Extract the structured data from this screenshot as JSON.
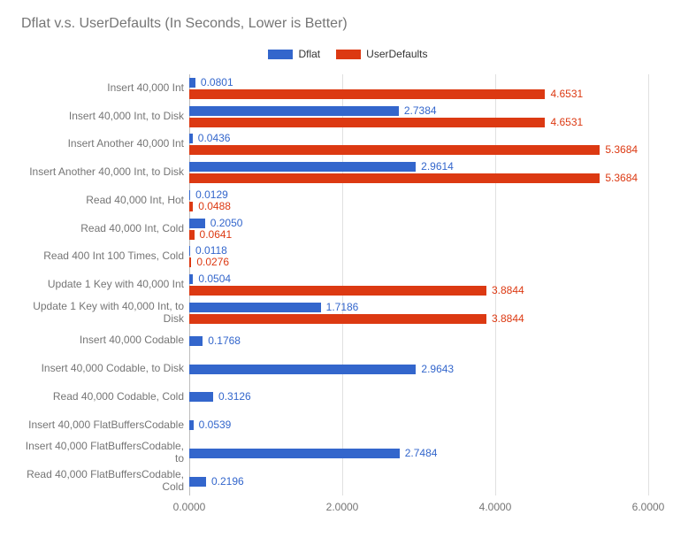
{
  "chart_data": {
    "type": "bar",
    "title": "Dflat v.s. UserDefaults (In Seconds, Lower is Better)",
    "xlabel": "",
    "ylabel": "",
    "xlim": [
      0,
      6
    ],
    "xticks": [
      0,
      2,
      4,
      6
    ],
    "xtick_labels": [
      "0.0000",
      "2.0000",
      "4.0000",
      "6.0000"
    ],
    "legend": [
      "Dflat",
      "UserDefaults"
    ],
    "colors": {
      "Dflat": "#3366cc",
      "UserDefaults": "#dc3912"
    },
    "categories": [
      "Insert 40,000 Int",
      "Insert 40,000 Int, to Disk",
      "Insert Another 40,000 Int",
      "Insert Another 40,000 Int, to Disk",
      "Read 40,000 Int, Hot",
      "Read 40,000 Int, Cold",
      "Read 400 Int 100 Times, Cold",
      "Update 1 Key with 40,000 Int",
      "Update 1 Key with 40,000 Int, to Disk",
      "Insert 40,000 Codable",
      "Insert 40,000 Codable, to Disk",
      "Read 40,000 Codable, Cold",
      "Insert 40,000 FlatBuffersCodable",
      "Insert 40,000 FlatBuffersCodable, to",
      "Read 40,000 FlatBuffersCodable, Cold"
    ],
    "series": [
      {
        "name": "Dflat",
        "values": [
          0.0801,
          2.7384,
          0.0436,
          2.9614,
          0.0129,
          0.205,
          0.0118,
          0.0504,
          1.7186,
          0.1768,
          2.9643,
          0.3126,
          0.0539,
          2.7484,
          0.2196
        ]
      },
      {
        "name": "UserDefaults",
        "values": [
          4.6531,
          4.6531,
          5.3684,
          5.3684,
          0.0488,
          0.0641,
          0.0276,
          3.8844,
          3.8844,
          null,
          null,
          null,
          null,
          null,
          null
        ]
      }
    ],
    "value_labels": {
      "Dflat": [
        "0.0801",
        "2.7384",
        "0.0436",
        "2.9614",
        "0.0129",
        "0.2050",
        "0.0118",
        "0.0504",
        "1.7186",
        "0.1768",
        "2.9643",
        "0.3126",
        "0.0539",
        "2.7484",
        "0.2196"
      ],
      "UserDefaults": [
        "4.6531",
        "4.6531",
        "5.3684",
        "5.3684",
        "0.0488",
        "0.0641",
        "0.0276",
        "3.8844",
        "3.8844",
        null,
        null,
        null,
        null,
        null,
        null
      ]
    }
  }
}
